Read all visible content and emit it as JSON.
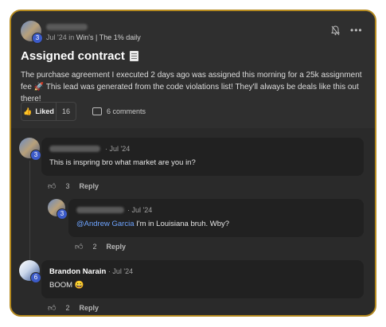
{
  "post": {
    "date": "Jul '24",
    "in_word": "in",
    "community": "Win's",
    "separator": "|",
    "group": "The 1% daily",
    "author_level": "3",
    "title": "Assigned contract",
    "body": "The purchase agreement I executed 2 days ago was assigned this morning for a 25k assignment fee 🚀 This lead was generated from the code violations list! They'll always be deals like this out there!",
    "like_label": "Liked",
    "like_count": "16",
    "comments_label": "6 comments"
  },
  "comments": [
    {
      "level": "3",
      "date": "Jul '24",
      "text": "This is inspring bro what market are you in?",
      "likes": "3",
      "reply_label": "Reply"
    },
    {
      "level": "3",
      "date": "Jul '24",
      "mention": "@Andrew Garcia",
      "text": " I'm in Louisiana bruh. Wby?",
      "likes": "2",
      "reply_label": "Reply"
    },
    {
      "author": "Brandon Narain",
      "level": "6",
      "date": "Jul '24",
      "text": "BOOM 😀",
      "likes": "2",
      "reply_label": "Reply"
    }
  ],
  "colors": {
    "accent_border": "#b58a1f",
    "level_badge": "#3c5bc9",
    "mention": "#6ea4ff",
    "liked": "#f1b43a"
  }
}
